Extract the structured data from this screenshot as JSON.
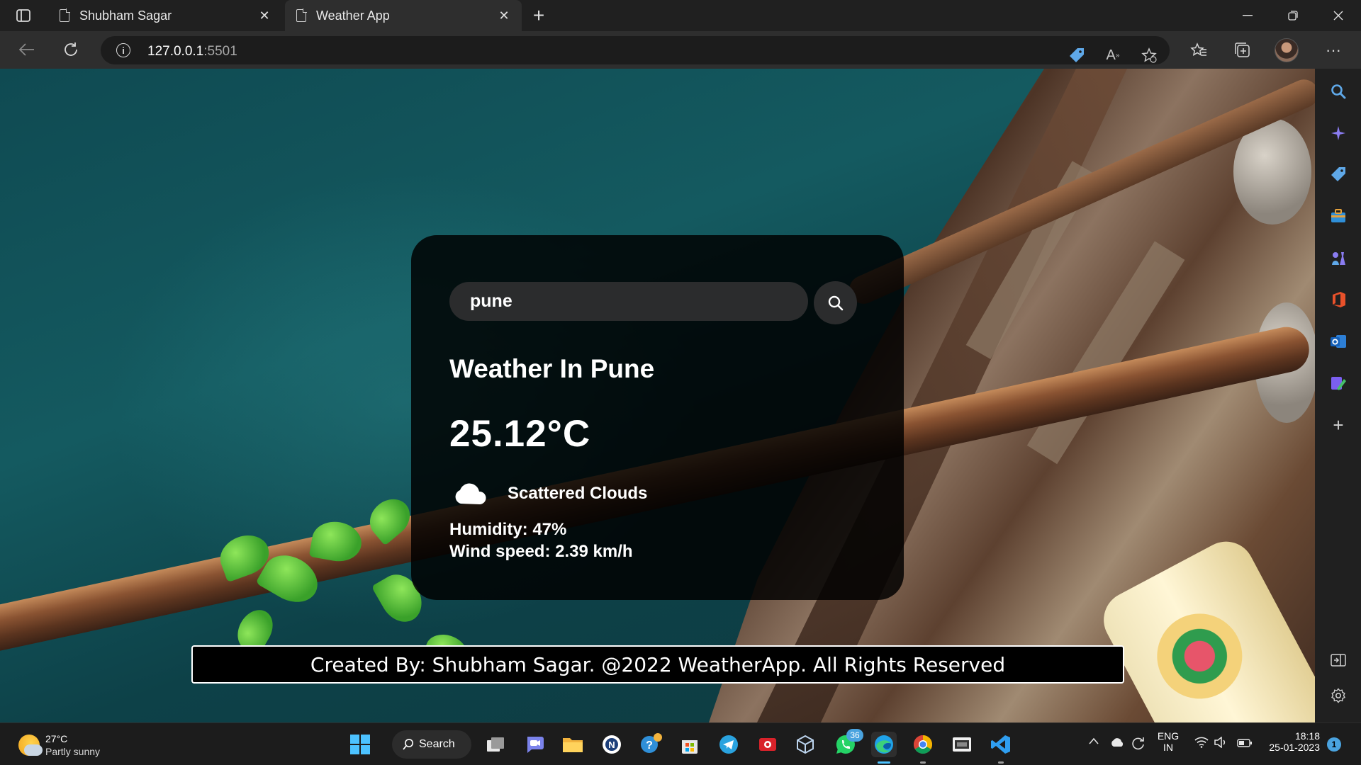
{
  "browser": {
    "tabs": [
      {
        "title": "Shubham Sagar",
        "active": false
      },
      {
        "title": "Weather App",
        "active": true
      }
    ],
    "address": {
      "host": "127.0.0.1",
      "port": ":5501"
    }
  },
  "weather_app": {
    "search": {
      "value": "pune",
      "placeholder": "Search"
    },
    "city_heading": "Weather In Pune",
    "temperature": "25.12°C",
    "description": "Scattered Clouds",
    "humidity": "Humidity: 47%",
    "wind_speed": "Wind speed: 2.39 km/h",
    "footer": "Created By: Shubham Sagar. @2022 WeatherApp. All Rights Reserved"
  },
  "sidebar": {
    "icons": [
      "search-icon",
      "copilot-icon",
      "shopping-tag-icon",
      "tools-icon",
      "games-icon",
      "office-icon",
      "outlook-icon",
      "drop-icon",
      "add-icon",
      "split-screen-icon",
      "settings-icon"
    ]
  },
  "taskbar": {
    "weather": {
      "temp": "27°C",
      "condition": "Partly sunny"
    },
    "search_label": "Search",
    "whatsapp_badge": "36",
    "language": {
      "lang": "ENG",
      "region": "IN"
    },
    "clock": {
      "time": "18:18",
      "date": "25-01-2023"
    },
    "notifications": "1"
  },
  "colors": {
    "accent": "#4aa3df",
    "card_bg": "#000000",
    "input_bg": "#2b2c2d"
  }
}
